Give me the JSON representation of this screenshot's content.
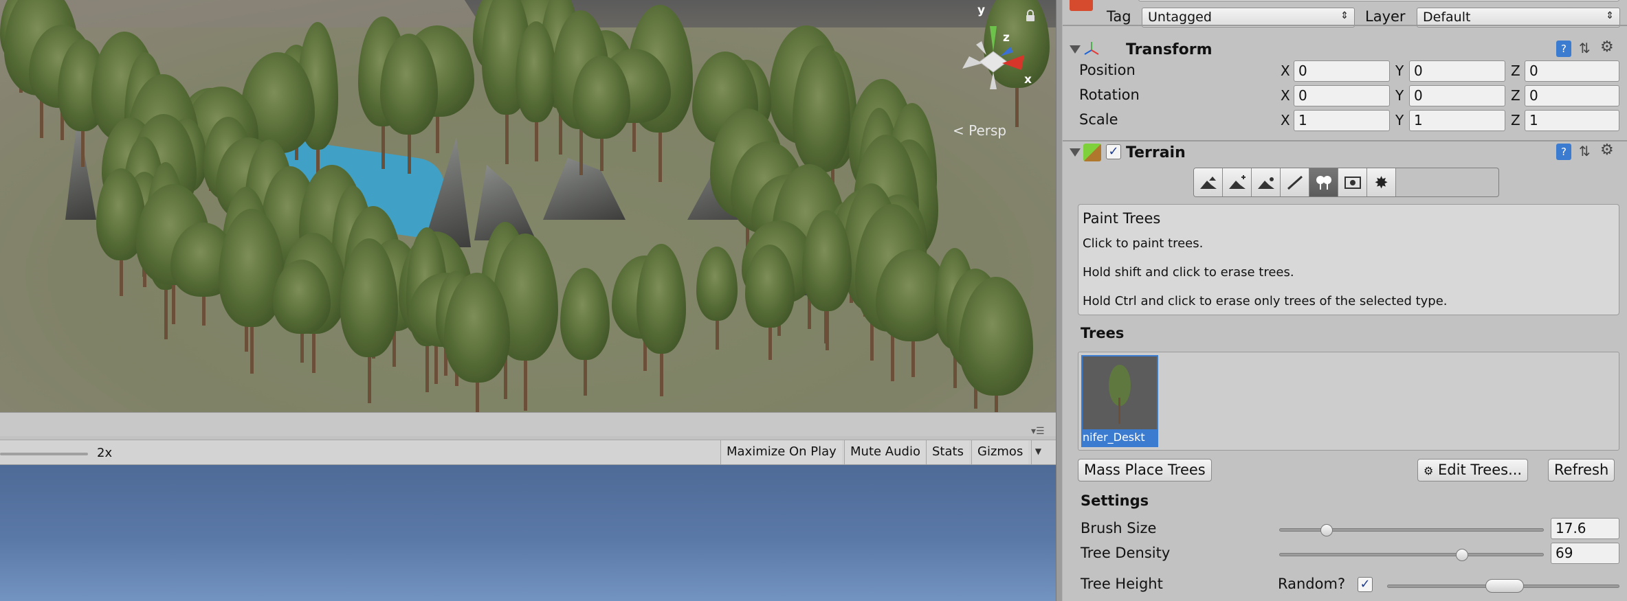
{
  "scene": {
    "gizmo_axis_x": "x",
    "gizmo_axis_y": "y",
    "gizmo_axis_z": "z",
    "projection_label": "< Persp"
  },
  "game_toolbar": {
    "scale_value": "2x",
    "maximize_on_play": "Maximize On Play",
    "mute_audio": "Mute Audio",
    "stats": "Stats",
    "gizmos": "Gizmos"
  },
  "inspector": {
    "tag_label": "Tag",
    "tag_value": "Untagged",
    "layer_label": "Layer",
    "layer_value": "Default",
    "transform": {
      "title": "Transform",
      "rows": [
        {
          "label": "Position",
          "x": "0",
          "y": "0",
          "z": "0"
        },
        {
          "label": "Rotation",
          "x": "0",
          "y": "0",
          "z": "0"
        },
        {
          "label": "Scale",
          "x": "1",
          "y": "1",
          "z": "1"
        }
      ],
      "axis_x": "X",
      "axis_y": "Y",
      "axis_z": "Z"
    },
    "terrain": {
      "title": "Terrain",
      "enabled": true,
      "tools": [
        "raise-lower-icon",
        "paint-height-icon",
        "smooth-height-icon",
        "paint-texture-icon",
        "place-trees-icon",
        "paint-details-icon",
        "terrain-settings-icon"
      ],
      "active_tool_index": 4,
      "help_title": "Paint Trees",
      "help_lines": [
        "Click to paint trees.",
        "Hold shift and click to erase trees.",
        "Hold Ctrl and click to erase only trees of the selected type."
      ],
      "trees_heading": "Trees",
      "tree_item_label": "nifer_Deskt",
      "mass_place_button": "Mass Place Trees",
      "edit_trees_button": "Edit Trees...",
      "refresh_button": "Refresh",
      "settings_heading": "Settings",
      "brush_size_label": "Brush Size",
      "brush_size_value": "17.6",
      "brush_size_fraction": 0.18,
      "tree_density_label": "Tree Density",
      "tree_density_value": "69",
      "tree_density_fraction": 0.69,
      "tree_height_label": "Tree Height",
      "random_label": "Random?",
      "random_checked": true
    }
  }
}
